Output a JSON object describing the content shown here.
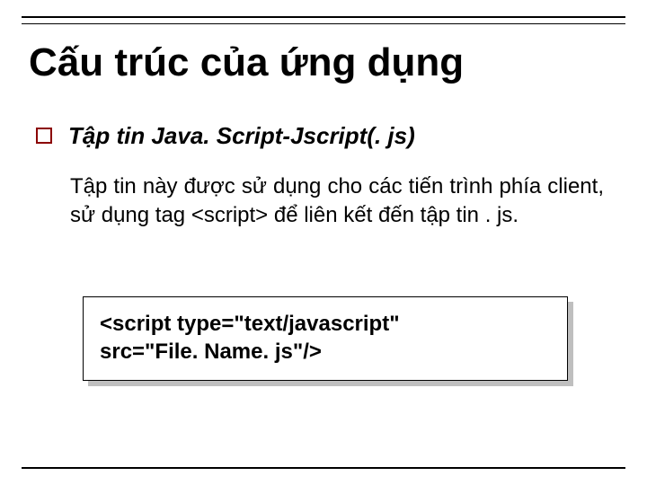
{
  "title": "Cấu trúc của ứng dụng",
  "bullet": "Tập tin Java. Script-Jscript(. js)",
  "body": "Tập tin này được sử dụng cho các tiến trình phía client, sử dụng tag <script> để liên kết đến tập tin . js.",
  "code_line1": "<script type=\"text/javascript\"",
  "code_line2": "src=\"File. Name. js\"/>"
}
